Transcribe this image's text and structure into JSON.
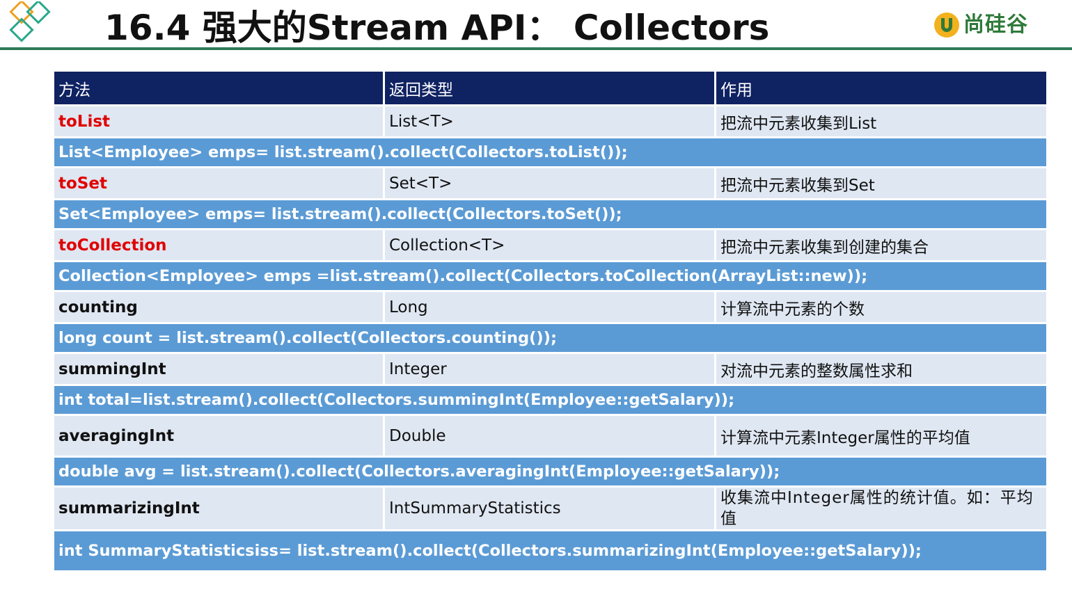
{
  "header": {
    "title": "16.4 强大的Stream API： Collectors",
    "brand": "尚硅谷"
  },
  "table": {
    "columns": [
      "方法",
      "返回类型",
      "作用"
    ],
    "rows": [
      {
        "method": "toList",
        "return_type": "List<T>",
        "purpose": "把流中元素收集到List",
        "example": "List<Employee> emps= list.stream().collect(Collectors.toList());"
      },
      {
        "method": "toSet",
        "return_type": "Set<T>",
        "purpose": "把流中元素收集到Set",
        "example": "Set<Employee> emps= list.stream().collect(Collectors.toSet());"
      },
      {
        "method": "toCollection",
        "return_type": "Collection<T>",
        "purpose": "把流中元素收集到创建的集合",
        "example": "Collection<Employee> emps =list.stream().collect(Collectors.toCollection(ArrayList::new));"
      },
      {
        "method": "counting",
        "return_type": "Long",
        "purpose": "计算流中元素的个数",
        "example": "long count = list.stream().collect(Collectors.counting());"
      },
      {
        "method": "summingInt",
        "return_type": "Integer",
        "purpose": "对流中元素的整数属性求和",
        "example": "int total=list.stream().collect(Collectors.summingInt(Employee::getSalary));"
      },
      {
        "method": "averagingInt",
        "return_type": "Double",
        "purpose": "计算流中元素Integer属性的平均值",
        "example": "double avg = list.stream().collect(Collectors.averagingInt(Employee::getSalary));"
      },
      {
        "method": "summarizingInt",
        "return_type": "IntSummaryStatistics",
        "purpose": "收集流中Integer属性的统计值。如：平均值",
        "example": "int SummaryStatisticsiss= list.stream().collect(Collectors.summarizingInt(Employee::getSalary));"
      }
    ]
  },
  "colors": {
    "header_bg": "#0f2262",
    "method_row_bg": "#dfe7f2",
    "code_row_bg": "#5b9bd5",
    "highlight_method": "#e00000",
    "rule": "#2f7a5a",
    "brand": "#2f7a3a"
  }
}
